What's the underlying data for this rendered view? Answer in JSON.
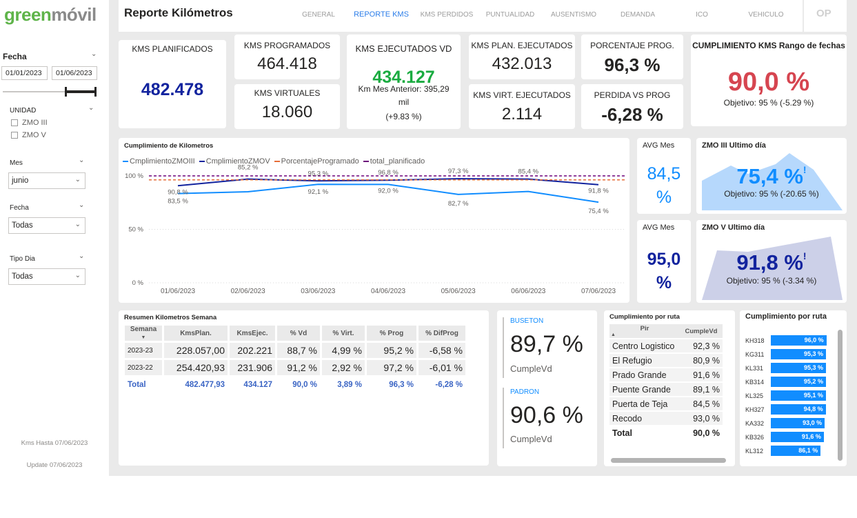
{
  "logo": {
    "part1": "green",
    "part2": "móvil"
  },
  "header": {
    "title": "Reporte Kilómetros",
    "nav": [
      "GENERAL",
      "REPORTE KMS",
      "KMS PERDIDOS",
      "PUNTUALIDAD",
      "AUSENTISMO",
      "DEMANDA",
      "ICO",
      "VEHICULO"
    ],
    "op": "OP"
  },
  "sidebar": {
    "fecha_label": "Fecha",
    "date_from": "01/01/2023",
    "date_to": "01/06/2023",
    "unidad_label": "UNIDAD",
    "unidad_options": [
      "ZMO III",
      "ZMO V"
    ],
    "mes_label": "Mes",
    "mes_value": "junio",
    "fecha2_label": "Fecha",
    "fecha2_value": "Todas",
    "tipodia_label": "Tipo Dia",
    "tipodia_value": "Todas",
    "kms_hasta": "Kms Hasta 07/06/2023",
    "update": "Update 07/06/2023"
  },
  "kpis": {
    "planificados": {
      "title": "KMS PLANIFICADOS",
      "value": "482.478"
    },
    "programados": {
      "title": "KMS PROGRAMADOS",
      "value": "464.418"
    },
    "virtuales": {
      "title": "KMS VIRTUALES",
      "value": "18.060"
    },
    "ejecutados": {
      "title": "KMS EJECUTADOS  VD",
      "value": "434.127",
      "sub1": "Km Mes Anterior: 395,29",
      "sub2": "mil",
      "sub3": "(+9.83 %)"
    },
    "plan_ejec": {
      "title": "KMS PLAN. EJECUTADOS",
      "value": "432.013"
    },
    "virt_ejec": {
      "title": "KMS VIRT. EJECUTADOS",
      "value": "2.114"
    },
    "porcentaje": {
      "title": "PORCENTAJE PROG.",
      "value": "96,3 %"
    },
    "perdida": {
      "title": "PERDIDA VS PROG",
      "value": "-6,28 %"
    },
    "cumplimiento": {
      "title": "CUMPLIMIENTO KMS Rango de fechas",
      "value": "90,0 %",
      "objetivo": "Objetivo: 95 % (-5.29 %)"
    }
  },
  "avg1": {
    "title": "AVG Mes",
    "value": "84,5",
    "unit": "%"
  },
  "avg2": {
    "title": "AVG Mes",
    "value": "95,0",
    "unit": "%"
  },
  "zmo3": {
    "title": "ZMO III Ultimo día",
    "value": "75,4 %",
    "mark": "!",
    "objetivo": "Objetivo: 95 % (-20.65 %)"
  },
  "zmo5": {
    "title": "ZMO V Ultimo día",
    "value": "91,8 %",
    "mark": "!",
    "objetivo": "Objetivo: 95 % (-3.34 %)"
  },
  "colors": {
    "zmo3": "#118dff",
    "zmo5": "#12239e",
    "prog": "#e66c37",
    "plan": "#6b007b",
    "red": "#d64550",
    "green": "#1aab40"
  },
  "chart_data": {
    "type": "line",
    "title": "Cumplimiento de Kilometros",
    "categories": [
      "01/06/2023",
      "02/06/2023",
      "03/06/2023",
      "04/06/2023",
      "05/06/2023",
      "06/06/2023",
      "07/06/2023"
    ],
    "yticks": [
      "100 %",
      "50 %",
      "0 %"
    ],
    "ylim": [
      0,
      100
    ],
    "series": [
      {
        "name": "CmplimientoZMOIII",
        "values": [
          83.5,
          85.2,
          92.1,
          92.0,
          82.7,
          85.4,
          75.4
        ],
        "labels": [
          "83,5 %",
          "",
          "92,1 %",
          "92,0 %",
          "82,7 %",
          "",
          "75,4 %"
        ]
      },
      {
        "name": "CmplimientoZMOV",
        "values": [
          90.8,
          97.0,
          95.3,
          96.0,
          97.3,
          97.0,
          91.8
        ],
        "labels": [
          "90,8 %",
          "85,2 %",
          "95,3 %",
          "96,8 %",
          "97,3 %",
          "85,4 %",
          "91,8 %"
        ]
      },
      {
        "name": "PorcentajeProgramado",
        "values": [
          96.3,
          96.3,
          96.3,
          96.3,
          96.3,
          96.3,
          96.3
        ]
      },
      {
        "name": "total_planificado",
        "values": [
          100,
          100,
          100,
          100,
          100,
          100,
          100
        ]
      }
    ]
  },
  "semana": {
    "title": "Resumen Kilometros Semana",
    "headers": [
      "Semana",
      "KmsPlan.",
      "KmsEjec.",
      "% Vd",
      "% Virt.",
      "% Prog",
      "% DifProg"
    ],
    "rows": [
      [
        "2023-23",
        "228.057,00",
        "202.221",
        "88,7 %",
        "4,99 %",
        "95,2 %",
        "-6,58 %"
      ],
      [
        "2023-22",
        "254.420,93",
        "231.906",
        "91,2 %",
        "2,92 %",
        "97,2 %",
        "-6,01 %"
      ]
    ],
    "total": [
      "Total",
      "482.477,93",
      "434.127",
      "90,0 %",
      "3,89 %",
      "96,3 %",
      "-6,28 %"
    ]
  },
  "buseton": {
    "title": "BUSETON",
    "value": "89,7 %",
    "sub": "CumpleVd"
  },
  "padron": {
    "title": "PADRON",
    "value": "90,6 %",
    "sub": "CumpleVd"
  },
  "ruta_table": {
    "title": "Cumplimiento por ruta",
    "headers": [
      "Pir",
      "CumpleVd"
    ],
    "rows": [
      [
        "Centro Logistico",
        "92,3 %"
      ],
      [
        "El Refugio",
        "80,9 %"
      ],
      [
        "Prado Grande",
        "91,6 %"
      ],
      [
        "Puente Grande",
        "89,1 %"
      ],
      [
        "Puerta de Teja",
        "84,5 %"
      ],
      [
        "Recodo",
        "93,0 %"
      ]
    ],
    "total": [
      "Total",
      "90,0 %"
    ]
  },
  "ruta_bars": {
    "title": "Cumplimiento por ruta",
    "items": [
      {
        "label": "KH318",
        "value": 96.0,
        "text": "96,0 %"
      },
      {
        "label": "KG311",
        "value": 95.3,
        "text": "95,3 %"
      },
      {
        "label": "KL331",
        "value": 95.3,
        "text": "95,3 %"
      },
      {
        "label": "KB314",
        "value": 95.2,
        "text": "95,2 %"
      },
      {
        "label": "KL325",
        "value": 95.1,
        "text": "95,1 %"
      },
      {
        "label": "KH327",
        "value": 94.8,
        "text": "94,8 %"
      },
      {
        "label": "KA332",
        "value": 93.0,
        "text": "93,0 %"
      },
      {
        "label": "KB326",
        "value": 91.6,
        "text": "91,6 %"
      },
      {
        "label": "KL312",
        "value": 86.1,
        "text": "86,1 %"
      }
    ]
  }
}
